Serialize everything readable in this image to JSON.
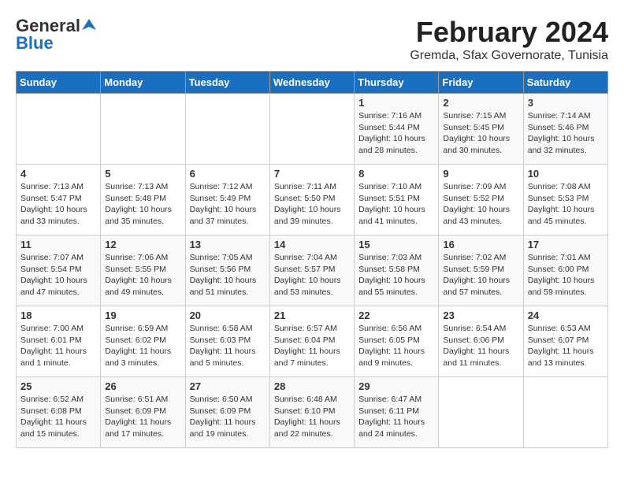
{
  "logo": {
    "line1": "General",
    "line2": "Blue"
  },
  "title": "February 2024",
  "subtitle": "Gremda, Sfax Governorate, Tunisia",
  "days_header": [
    "Sunday",
    "Monday",
    "Tuesday",
    "Wednesday",
    "Thursday",
    "Friday",
    "Saturday"
  ],
  "weeks": [
    [
      {
        "day": "",
        "sunrise": "",
        "sunset": "",
        "daylight": ""
      },
      {
        "day": "",
        "sunrise": "",
        "sunset": "",
        "daylight": ""
      },
      {
        "day": "",
        "sunrise": "",
        "sunset": "",
        "daylight": ""
      },
      {
        "day": "",
        "sunrise": "",
        "sunset": "",
        "daylight": ""
      },
      {
        "day": "1",
        "sunrise": "Sunrise: 7:16 AM",
        "sunset": "Sunset: 5:44 PM",
        "daylight": "Daylight: 10 hours and 28 minutes."
      },
      {
        "day": "2",
        "sunrise": "Sunrise: 7:15 AM",
        "sunset": "Sunset: 5:45 PM",
        "daylight": "Daylight: 10 hours and 30 minutes."
      },
      {
        "day": "3",
        "sunrise": "Sunrise: 7:14 AM",
        "sunset": "Sunset: 5:46 PM",
        "daylight": "Daylight: 10 hours and 32 minutes."
      }
    ],
    [
      {
        "day": "4",
        "sunrise": "Sunrise: 7:13 AM",
        "sunset": "Sunset: 5:47 PM",
        "daylight": "Daylight: 10 hours and 33 minutes."
      },
      {
        "day": "5",
        "sunrise": "Sunrise: 7:13 AM",
        "sunset": "Sunset: 5:48 PM",
        "daylight": "Daylight: 10 hours and 35 minutes."
      },
      {
        "day": "6",
        "sunrise": "Sunrise: 7:12 AM",
        "sunset": "Sunset: 5:49 PM",
        "daylight": "Daylight: 10 hours and 37 minutes."
      },
      {
        "day": "7",
        "sunrise": "Sunrise: 7:11 AM",
        "sunset": "Sunset: 5:50 PM",
        "daylight": "Daylight: 10 hours and 39 minutes."
      },
      {
        "day": "8",
        "sunrise": "Sunrise: 7:10 AM",
        "sunset": "Sunset: 5:51 PM",
        "daylight": "Daylight: 10 hours and 41 minutes."
      },
      {
        "day": "9",
        "sunrise": "Sunrise: 7:09 AM",
        "sunset": "Sunset: 5:52 PM",
        "daylight": "Daylight: 10 hours and 43 minutes."
      },
      {
        "day": "10",
        "sunrise": "Sunrise: 7:08 AM",
        "sunset": "Sunset: 5:53 PM",
        "daylight": "Daylight: 10 hours and 45 minutes."
      }
    ],
    [
      {
        "day": "11",
        "sunrise": "Sunrise: 7:07 AM",
        "sunset": "Sunset: 5:54 PM",
        "daylight": "Daylight: 10 hours and 47 minutes."
      },
      {
        "day": "12",
        "sunrise": "Sunrise: 7:06 AM",
        "sunset": "Sunset: 5:55 PM",
        "daylight": "Daylight: 10 hours and 49 minutes."
      },
      {
        "day": "13",
        "sunrise": "Sunrise: 7:05 AM",
        "sunset": "Sunset: 5:56 PM",
        "daylight": "Daylight: 10 hours and 51 minutes."
      },
      {
        "day": "14",
        "sunrise": "Sunrise: 7:04 AM",
        "sunset": "Sunset: 5:57 PM",
        "daylight": "Daylight: 10 hours and 53 minutes."
      },
      {
        "day": "15",
        "sunrise": "Sunrise: 7:03 AM",
        "sunset": "Sunset: 5:58 PM",
        "daylight": "Daylight: 10 hours and 55 minutes."
      },
      {
        "day": "16",
        "sunrise": "Sunrise: 7:02 AM",
        "sunset": "Sunset: 5:59 PM",
        "daylight": "Daylight: 10 hours and 57 minutes."
      },
      {
        "day": "17",
        "sunrise": "Sunrise: 7:01 AM",
        "sunset": "Sunset: 6:00 PM",
        "daylight": "Daylight: 10 hours and 59 minutes."
      }
    ],
    [
      {
        "day": "18",
        "sunrise": "Sunrise: 7:00 AM",
        "sunset": "Sunset: 6:01 PM",
        "daylight": "Daylight: 11 hours and 1 minute."
      },
      {
        "day": "19",
        "sunrise": "Sunrise: 6:59 AM",
        "sunset": "Sunset: 6:02 PM",
        "daylight": "Daylight: 11 hours and 3 minutes."
      },
      {
        "day": "20",
        "sunrise": "Sunrise: 6:58 AM",
        "sunset": "Sunset: 6:03 PM",
        "daylight": "Daylight: 11 hours and 5 minutes."
      },
      {
        "day": "21",
        "sunrise": "Sunrise: 6:57 AM",
        "sunset": "Sunset: 6:04 PM",
        "daylight": "Daylight: 11 hours and 7 minutes."
      },
      {
        "day": "22",
        "sunrise": "Sunrise: 6:56 AM",
        "sunset": "Sunset: 6:05 PM",
        "daylight": "Daylight: 11 hours and 9 minutes."
      },
      {
        "day": "23",
        "sunrise": "Sunrise: 6:54 AM",
        "sunset": "Sunset: 6:06 PM",
        "daylight": "Daylight: 11 hours and 11 minutes."
      },
      {
        "day": "24",
        "sunrise": "Sunrise: 6:53 AM",
        "sunset": "Sunset: 6:07 PM",
        "daylight": "Daylight: 11 hours and 13 minutes."
      }
    ],
    [
      {
        "day": "25",
        "sunrise": "Sunrise: 6:52 AM",
        "sunset": "Sunset: 6:08 PM",
        "daylight": "Daylight: 11 hours and 15 minutes."
      },
      {
        "day": "26",
        "sunrise": "Sunrise: 6:51 AM",
        "sunset": "Sunset: 6:09 PM",
        "daylight": "Daylight: 11 hours and 17 minutes."
      },
      {
        "day": "27",
        "sunrise": "Sunrise: 6:50 AM",
        "sunset": "Sunset: 6:09 PM",
        "daylight": "Daylight: 11 hours and 19 minutes."
      },
      {
        "day": "28",
        "sunrise": "Sunrise: 6:48 AM",
        "sunset": "Sunset: 6:10 PM",
        "daylight": "Daylight: 11 hours and 22 minutes."
      },
      {
        "day": "29",
        "sunrise": "Sunrise: 6:47 AM",
        "sunset": "Sunset: 6:11 PM",
        "daylight": "Daylight: 11 hours and 24 minutes."
      },
      {
        "day": "",
        "sunrise": "",
        "sunset": "",
        "daylight": ""
      },
      {
        "day": "",
        "sunrise": "",
        "sunset": "",
        "daylight": ""
      }
    ]
  ]
}
